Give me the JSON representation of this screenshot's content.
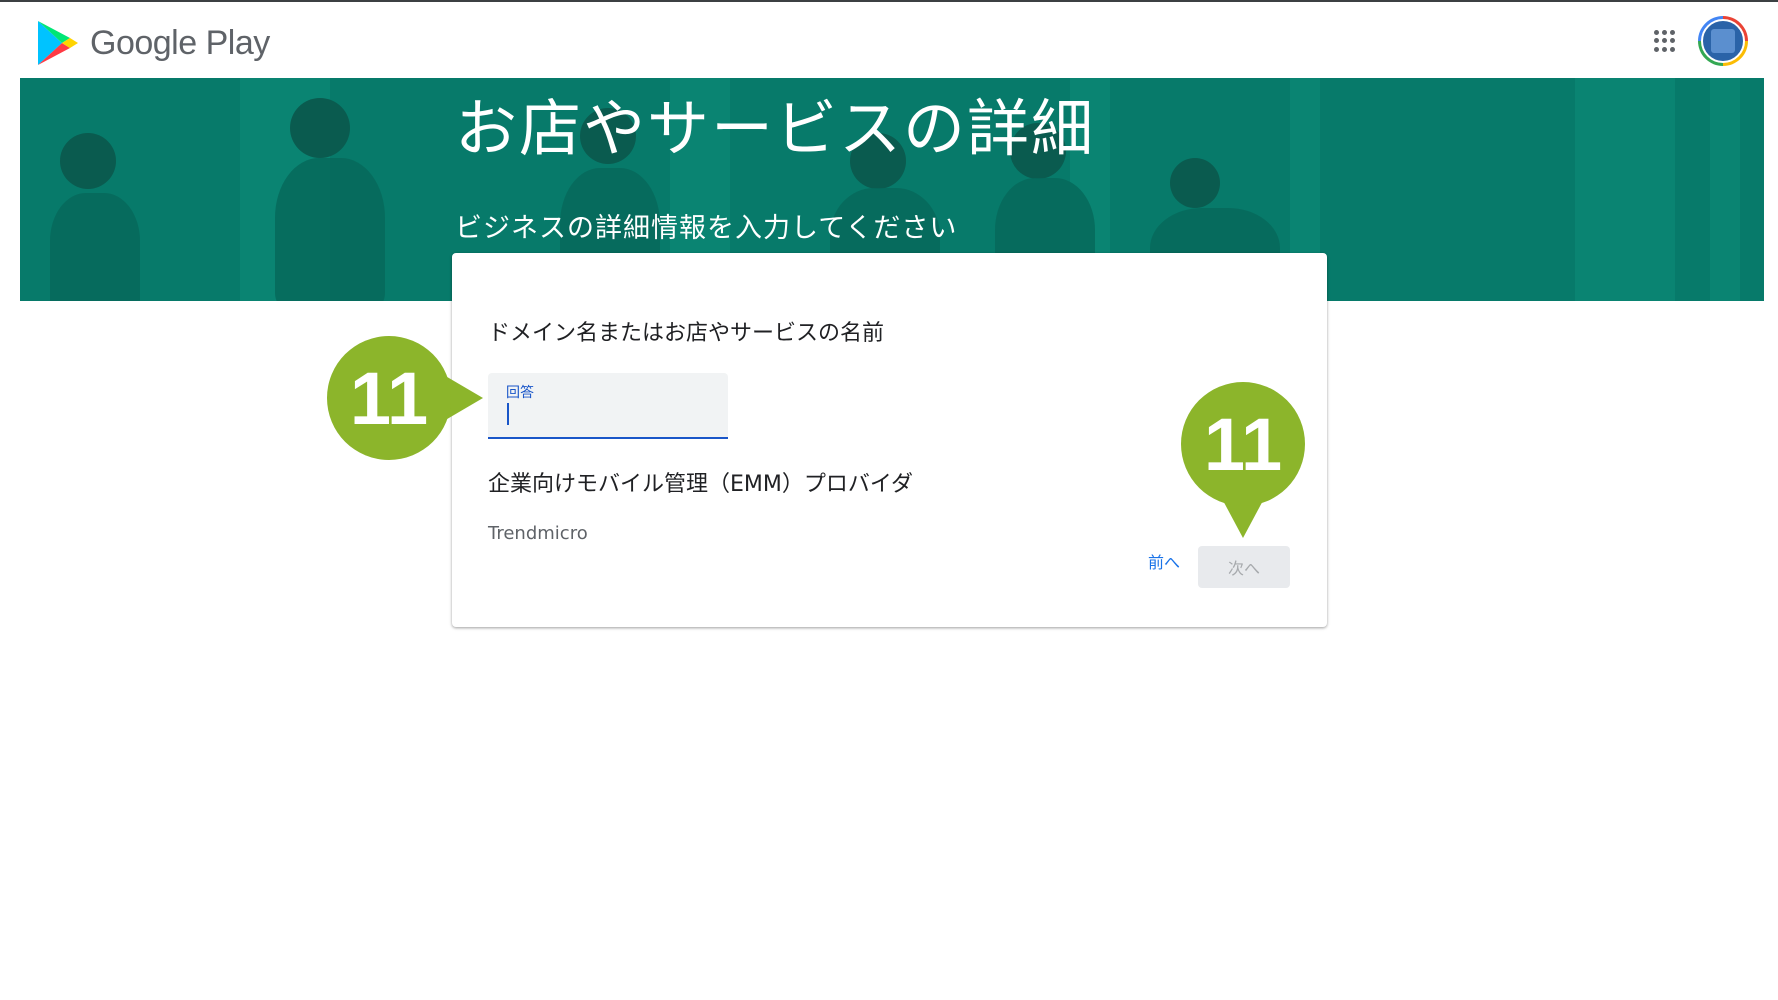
{
  "header": {
    "logo_text": "Google Play",
    "apps_icon": "apps-grid-icon",
    "avatar_icon": "account-avatar-icon"
  },
  "banner": {
    "title": "お店やサービスの詳細",
    "subtitle": "ビジネスの詳細情報を入力してください"
  },
  "form": {
    "question1": "ドメイン名またはお店やサービスの名前",
    "input_label": "回答",
    "input_value": "",
    "question2": "企業向けモバイル管理（EMM）プロバイダ",
    "answer2": "Trendmicro",
    "back_label": "前へ",
    "next_label": "次へ"
  },
  "callouts": {
    "left_number": "11",
    "right_number": "11"
  },
  "colors": {
    "banner": "#077a6a",
    "accent_blue": "#1a73e8",
    "callout_green": "#8cb52b"
  }
}
